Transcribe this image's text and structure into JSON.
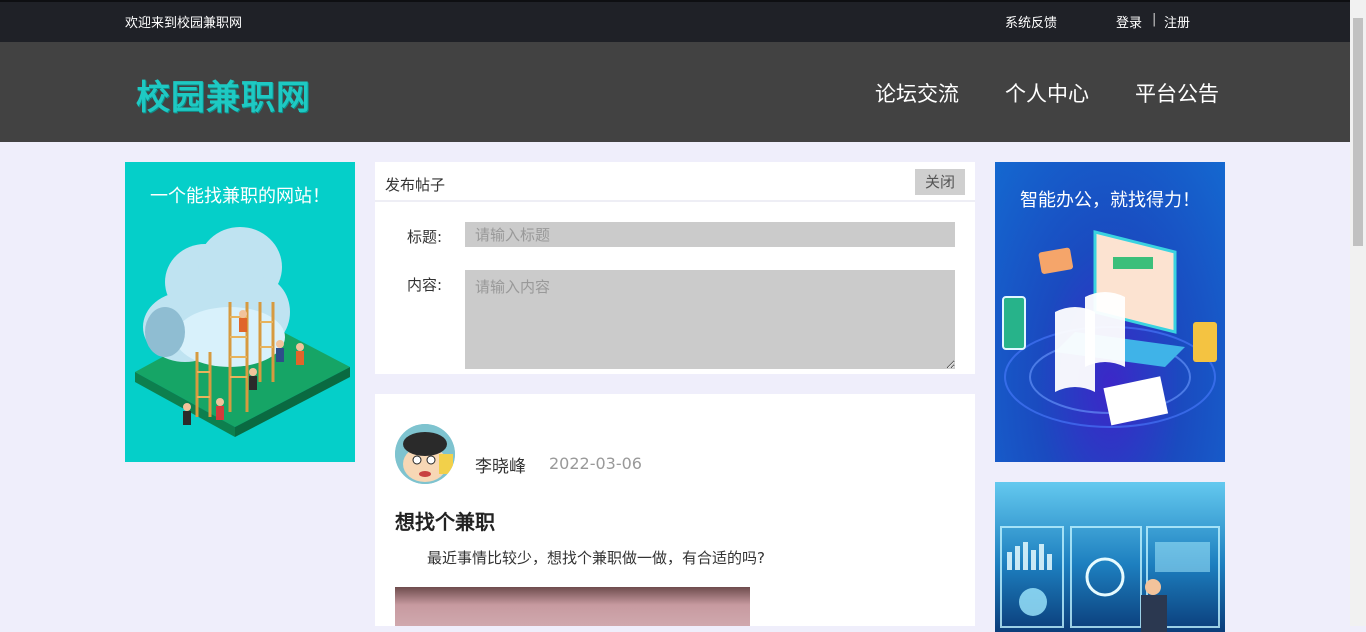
{
  "topbar": {
    "welcome": "欢迎来到校园兼职网",
    "feedback": "系统反馈",
    "login": "登录",
    "separator": "|",
    "register": "注册"
  },
  "header": {
    "logo": "校园兼职网",
    "nav": [
      "论坛交流",
      "个人中心",
      "平台公告"
    ]
  },
  "left_ad": {
    "caption": "一个能找兼职的网站！"
  },
  "post_form": {
    "title": "发布帖子",
    "close": "关闭",
    "title_label": "标题:",
    "title_placeholder": "请输入标题",
    "content_label": "内容:",
    "content_placeholder": "请输入内容"
  },
  "post": {
    "author": "李晓峰",
    "date": "2022-03-06",
    "title": "想找个兼职",
    "body": "最近事情比较少，想找个兼职做一做，有合适的吗?"
  },
  "right_ad": {
    "caption": "智能办公，就找得力！"
  },
  "colors": {
    "accent": "#05cfc9",
    "header_bg": "#424242",
    "topbar_bg": "#1f2127",
    "page_bg": "#efeefb"
  }
}
